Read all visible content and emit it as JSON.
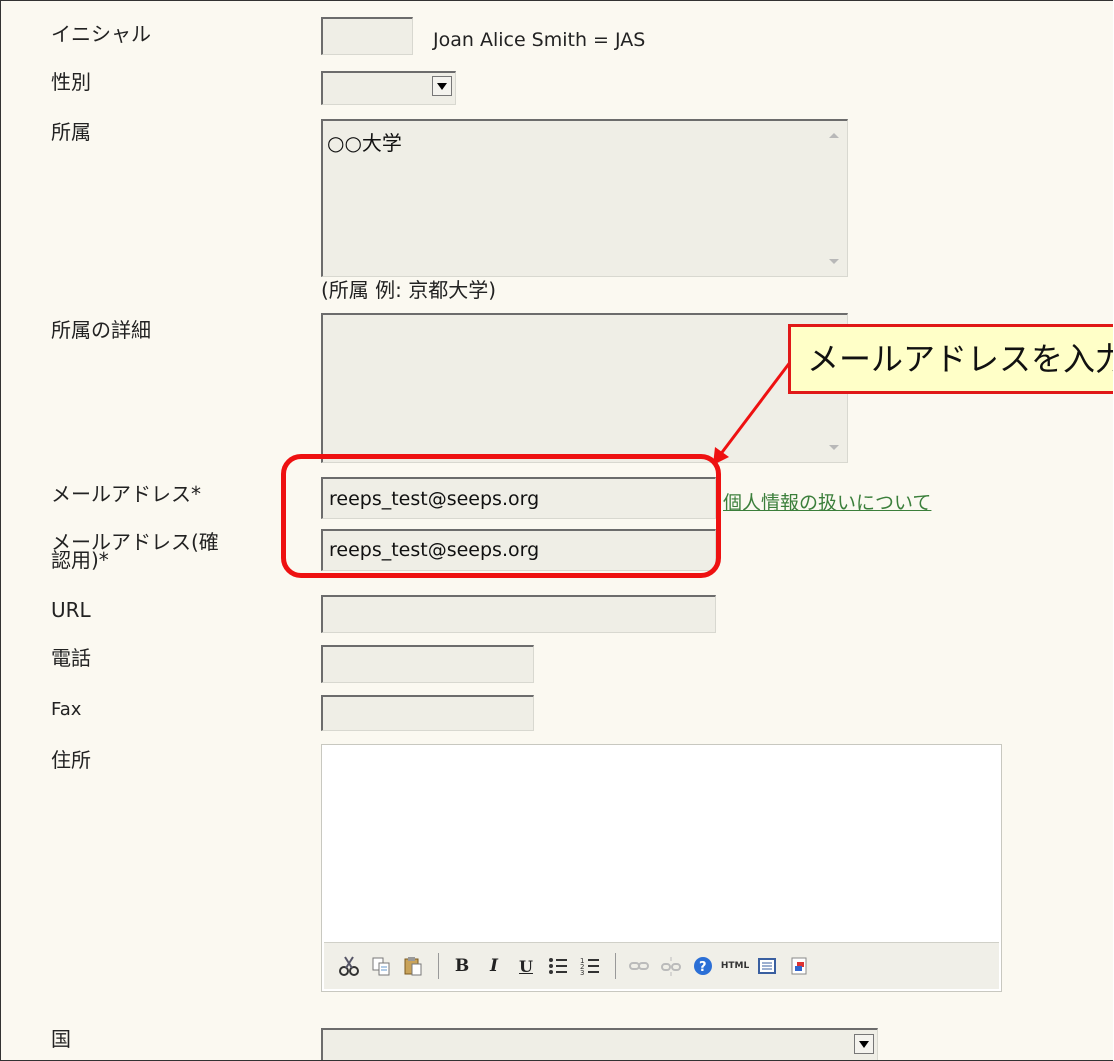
{
  "form": {
    "initials": {
      "label": "イニシャル",
      "value": "",
      "hint": "Joan Alice Smith = JAS"
    },
    "gender": {
      "label": "性別",
      "selected": ""
    },
    "affiliation": {
      "label": "所属",
      "value": "○○大学",
      "hint": "(所属 例: 京都大学)"
    },
    "affiliation_detail": {
      "label": "所属の詳細",
      "value": ""
    },
    "email": {
      "label": "メールアドレス*",
      "value": "reeps_test@seeps.org",
      "link": "個人情報の扱いについて"
    },
    "email_confirm": {
      "label_line1": "メールアドレス(確",
      "label_line2": "認用)*",
      "value": "reeps_test@seeps.org"
    },
    "url": {
      "label": "URL",
      "value": ""
    },
    "phone": {
      "label": "電話",
      "value": ""
    },
    "fax": {
      "label": "Fax",
      "value": ""
    },
    "address": {
      "label": "住所",
      "value": ""
    },
    "country": {
      "label": "国",
      "selected": ""
    }
  },
  "callout": {
    "text": "メールアドレスを入力"
  },
  "colors": {
    "highlight": "#ee1111",
    "link": "#3b7f3b",
    "callout_bg": "#ffffc8"
  },
  "toolbar_icons": [
    "cut-icon",
    "copy-icon",
    "paste-icon",
    "bold-icon",
    "italic-icon",
    "underline-icon",
    "bullet-list-icon",
    "numbered-list-icon",
    "link-icon",
    "unlink-icon",
    "help-icon",
    "html-icon",
    "source-icon",
    "color-icon"
  ]
}
